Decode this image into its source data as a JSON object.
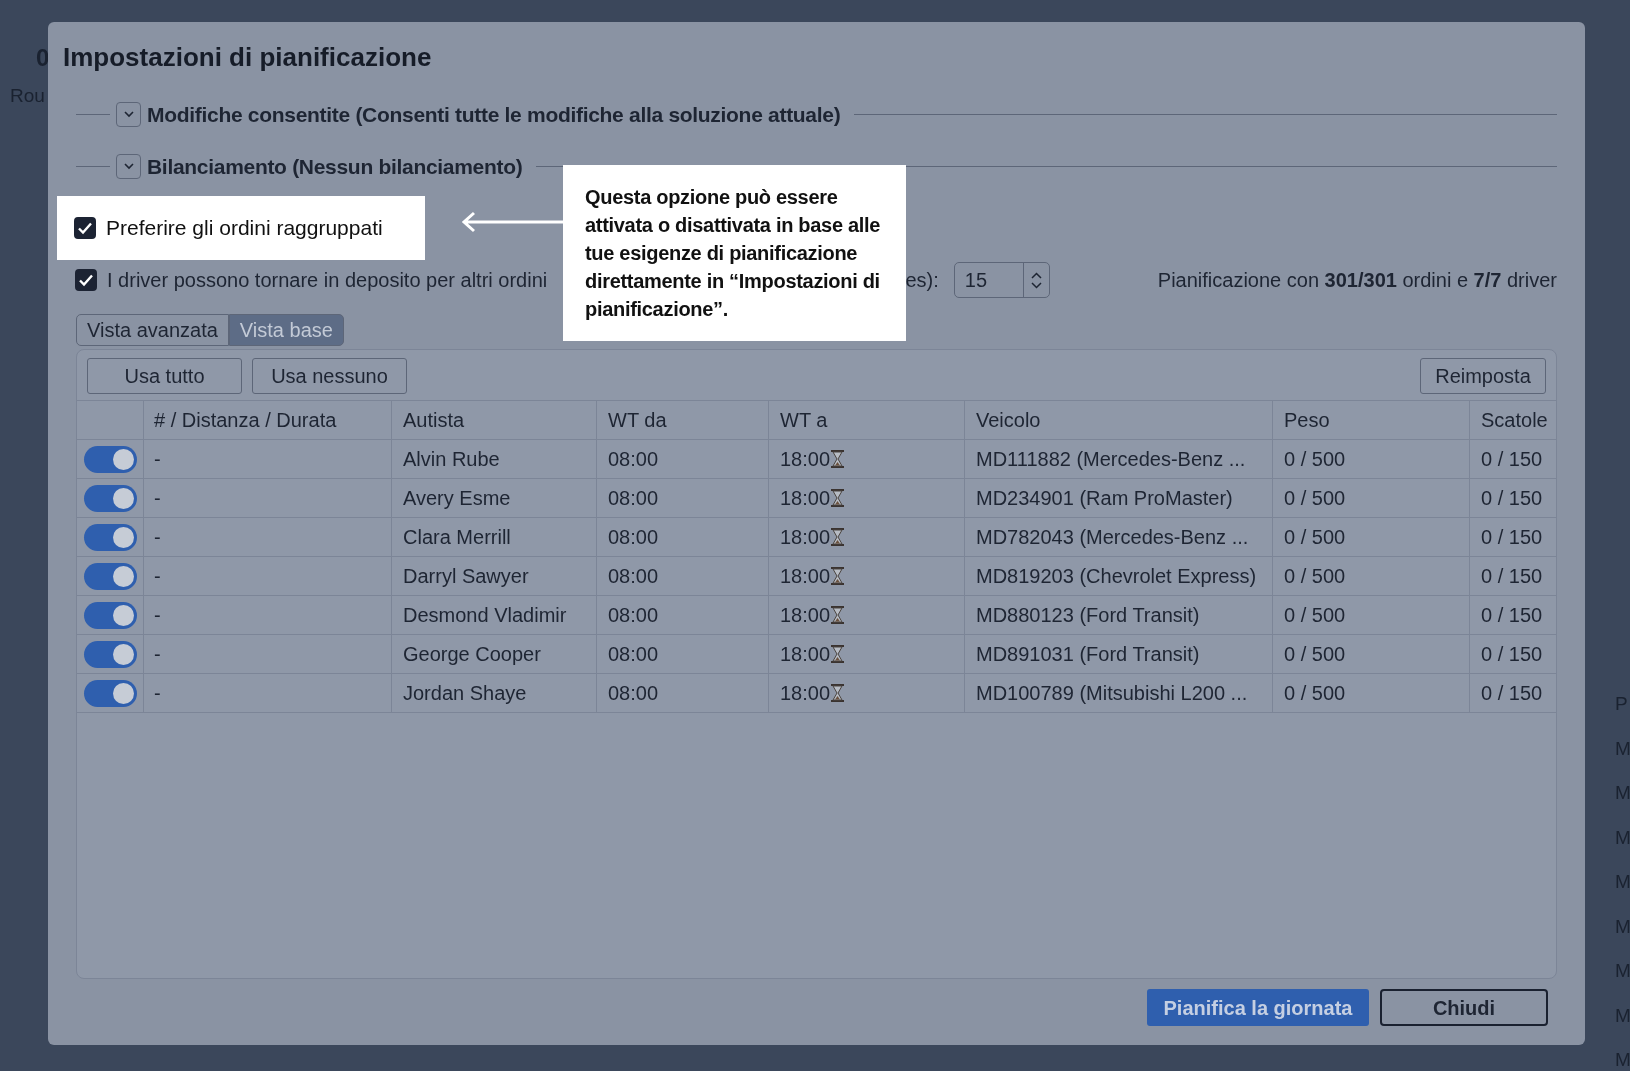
{
  "background": {
    "left_texts": [
      "0",
      "Rou"
    ],
    "right_texts": [
      "P",
      "M",
      "M",
      "M",
      "M",
      "M",
      "M",
      "M",
      "M"
    ]
  },
  "dialog": {
    "title": "Impostazioni di pianificazione",
    "sections": [
      {
        "label": "Modifiche consentite (Consenti tutte le modifiche alla soluzione attuale)"
      },
      {
        "label": "Bilanciamento (Nessun bilanciamento)"
      }
    ],
    "options": [
      {
        "label": "Preferire gli ordini raggruppati",
        "checked": true,
        "highlighted": true
      },
      {
        "label": "I driver possono tornare in deposito per altri ordini",
        "checked": true,
        "highlighted": false
      }
    ],
    "tooltip": "Questa opzione può essere attivata o disattivata in base alle tue esigenze di pianificazione direttamente in “Impostazioni di pianificazione”.",
    "field_label": "es):",
    "field_value": "15",
    "summary": "Pianificazione con **301/301** ordini e **7/7** driver",
    "tabs": [
      {
        "label": "Vista avanzata",
        "selected": false
      },
      {
        "label": "Vista base",
        "selected": true
      }
    ],
    "left_buttons": [
      "Usa tutto",
      "Usa nessuno"
    ],
    "reset_button": "Reimposta",
    "table": {
      "columns": [
        "# / Distanza / Durata",
        "Autista",
        "WT da",
        "WT a",
        "Veicolo",
        "Peso",
        "Scatole"
      ],
      "rows": [
        {
          "on": true,
          "cells": [
            "-",
            "Alvin Rube",
            "08:00",
            "18:00",
            "MD111882 (Mercedes-Benz ...",
            "0 / 500",
            "0 / 150"
          ]
        },
        {
          "on": true,
          "cells": [
            "-",
            "Avery Esme",
            "08:00",
            "18:00",
            "MD234901 (Ram ProMaster)",
            "0 / 500",
            "0 / 150"
          ]
        },
        {
          "on": true,
          "cells": [
            "-",
            "Clara Merrill",
            "08:00",
            "18:00",
            "MD782043 (Mercedes-Benz ...",
            "0 / 500",
            "0 / 150"
          ]
        },
        {
          "on": true,
          "cells": [
            "-",
            "Darryl Sawyer",
            "08:00",
            "18:00",
            "MD819203 (Chevrolet Express)",
            "0 / 500",
            "0 / 150"
          ]
        },
        {
          "on": true,
          "cells": [
            "-",
            "Desmond Vladimir",
            "08:00",
            "18:00",
            "MD880123 (Ford Transit)",
            "0 / 500",
            "0 / 150"
          ]
        },
        {
          "on": true,
          "cells": [
            "-",
            "George Cooper",
            "08:00",
            "18:00",
            "MD891031 (Ford Transit)",
            "0 / 500",
            "0 / 150"
          ]
        },
        {
          "on": true,
          "cells": [
            "-",
            "Jordan Shaye",
            "08:00",
            "18:00",
            "MD100789 (Mitsubishi L200 ...",
            "0 / 500",
            "0 / 150"
          ]
        }
      ]
    },
    "primary_button": "Pianifica la giornata",
    "close_button": "Chiudi"
  }
}
